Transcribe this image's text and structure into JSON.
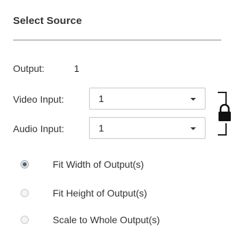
{
  "panel": {
    "title": "Select Source"
  },
  "output": {
    "label": "Output:",
    "value": "1"
  },
  "video_input": {
    "label": "Video Input:",
    "selected": "1"
  },
  "audio_input": {
    "label": "Audio Input:",
    "selected": "1"
  },
  "lock": {
    "icon": "lock-icon",
    "state": "locked"
  },
  "fit_options": [
    {
      "label": "Fit Width of Output(s)",
      "checked": true
    },
    {
      "label": "Fit Height of Output(s)",
      "checked": false
    },
    {
      "label": "Scale to Whole Output(s)",
      "checked": false
    }
  ]
}
